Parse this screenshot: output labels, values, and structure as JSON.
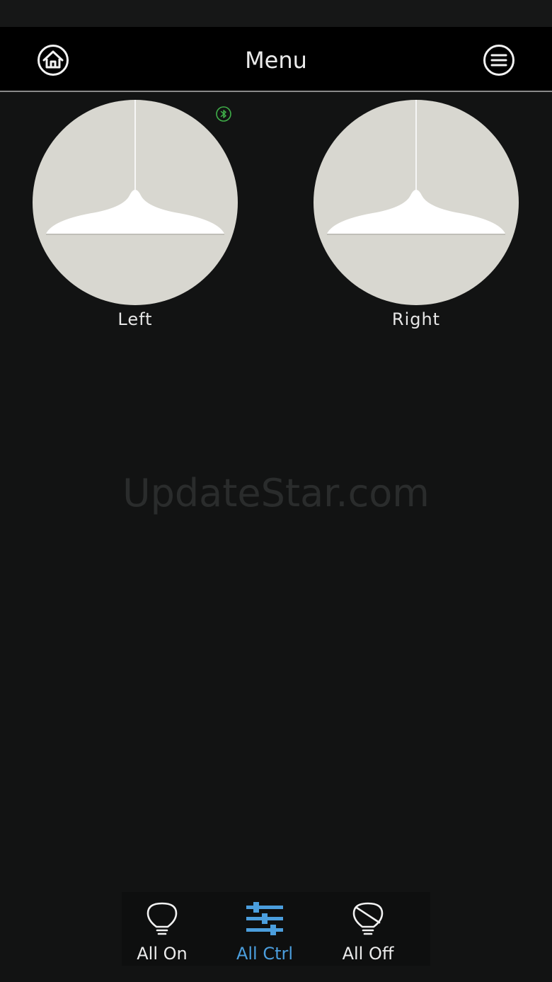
{
  "header": {
    "title": "Menu",
    "home_icon": "home-icon",
    "menu_icon": "hamburger-menu-icon"
  },
  "devices": [
    {
      "label": "Left",
      "icon": "pendant-lamp-icon",
      "bluetooth_connected": true
    },
    {
      "label": "Right",
      "icon": "pendant-lamp-icon",
      "bluetooth_connected": false
    }
  ],
  "watermark": "UpdateStar.com",
  "tabbar": {
    "items": [
      {
        "label": "All On",
        "icon": "bulb-on-icon",
        "active": false
      },
      {
        "label": "All Ctrl",
        "icon": "sliders-icon",
        "active": true
      },
      {
        "label": "All Off",
        "icon": "bulb-off-icon",
        "active": false
      }
    ]
  },
  "colors": {
    "background": "#121313",
    "header": "#000000",
    "accent": "#4b9edd",
    "bluetooth": "#3fae49",
    "lamp_circle": "#d8d7d0"
  }
}
